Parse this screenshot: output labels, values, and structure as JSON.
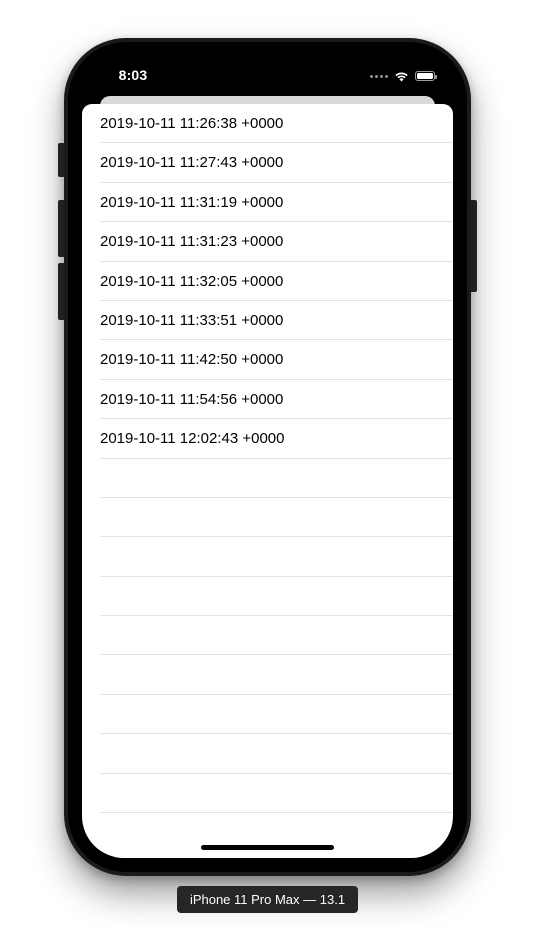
{
  "status_bar": {
    "time": "8:03",
    "icons": [
      "cellular-signal-icon",
      "wifi-icon",
      "battery-icon"
    ]
  },
  "list": {
    "rows": [
      {
        "label": "2019-10-11 11:26:38 +0000"
      },
      {
        "label": "2019-10-11 11:27:43 +0000"
      },
      {
        "label": "2019-10-11 11:31:19 +0000"
      },
      {
        "label": "2019-10-11 11:31:23 +0000"
      },
      {
        "label": "2019-10-11 11:32:05 +0000"
      },
      {
        "label": "2019-10-11 11:33:51 +0000"
      },
      {
        "label": "2019-10-11 11:42:50 +0000"
      },
      {
        "label": "2019-10-11 11:54:56 +0000"
      },
      {
        "label": "2019-10-11 12:02:43 +0000"
      },
      {
        "label": ""
      },
      {
        "label": ""
      },
      {
        "label": ""
      },
      {
        "label": ""
      },
      {
        "label": ""
      },
      {
        "label": ""
      },
      {
        "label": ""
      },
      {
        "label": ""
      },
      {
        "label": ""
      }
    ]
  },
  "device_caption": "iPhone 11 Pro Max — 13.1",
  "colors": {
    "device_frame": "#1a1a1a",
    "screen_background": "#000000",
    "sheet_background": "#ffffff",
    "separator": "#e3e3e6",
    "caption_background": "#262626"
  }
}
